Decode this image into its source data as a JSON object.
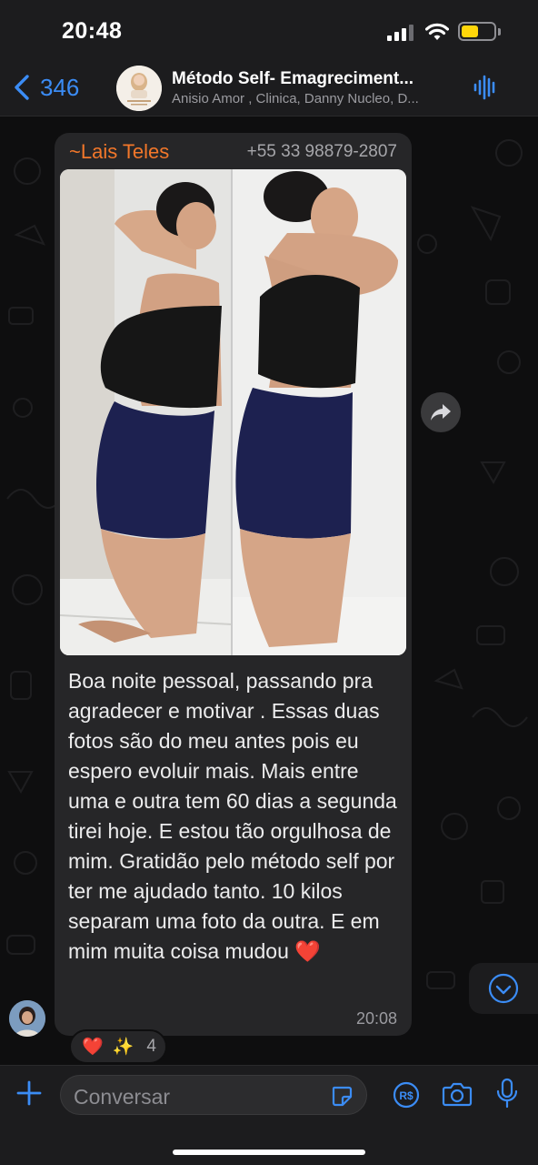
{
  "status": {
    "time": "20:48"
  },
  "header": {
    "back_count": "346",
    "title": "Método Self- Emagreciment...",
    "subtitle": "Anisio Amor , Clinica, Danny Nucleo, D..."
  },
  "message": {
    "sender": "~Lais Teles",
    "phone": "+55 33 98879-2807",
    "text": "Boa noite pessoal, passando pra agradecer e motivar . Essas duas fotos são do meu antes pois eu espero evoluir mais. Mais entre uma e outra tem 60 dias a segunda tirei hoje. E estou tão orgulhosa de mim. Gratidão pelo método self por ter me ajudado tanto. 10 kilos separam uma foto da outra. E em mim muita coisa mudou",
    "emoji": "❤️",
    "time": "20:08",
    "reactions": {
      "emoji_1": "❤️",
      "emoji_2": "✨",
      "count": "4"
    }
  },
  "input": {
    "placeholder": "Conversar"
  },
  "colors": {
    "accent": "#3b8cf5",
    "sender_name": "#f2772a",
    "bubble": "#262628",
    "battery": "#ffd60a"
  }
}
